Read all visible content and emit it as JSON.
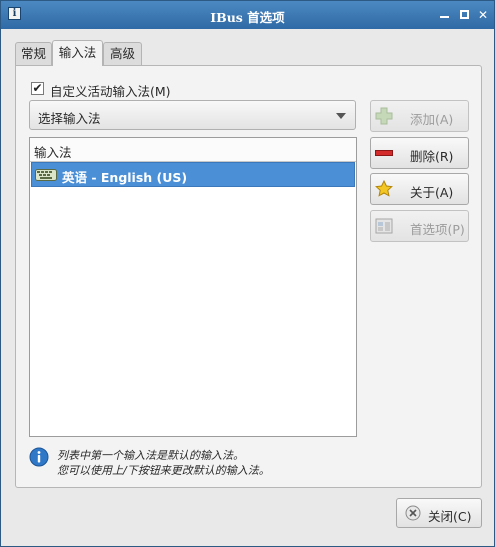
{
  "window": {
    "title": "IBus 首选项",
    "menu_glyph": "i",
    "close_glyph": "✕"
  },
  "tabs": [
    {
      "label": "常规",
      "active": false
    },
    {
      "label": "输入法",
      "active": true
    },
    {
      "label": "高级",
      "active": false
    }
  ],
  "custom_active": {
    "label": "自定义活动输入法(M)",
    "checked": true,
    "check_glyph": "✔"
  },
  "selector": {
    "placeholder": "选择输入法"
  },
  "list": {
    "header": "输入法",
    "items": [
      {
        "label": "英语 - English (US)",
        "selected": true,
        "icon": "keyboard-icon"
      }
    ]
  },
  "buttons": {
    "add": {
      "label": "添加(A)",
      "enabled": false,
      "icon": "plus-icon"
    },
    "remove": {
      "label": "删除(R)",
      "enabled": true,
      "icon": "minus-icon"
    },
    "about": {
      "label": "关于(A)",
      "enabled": true,
      "icon": "star-icon"
    },
    "prefs": {
      "label": "首选项(P)",
      "enabled": false,
      "icon": "preferences-icon"
    }
  },
  "info": {
    "line1": "列表中第一个输入法是默认的输入法。",
    "line2": "您可以使用上/下按钮来更改默认的输入法。"
  },
  "footer": {
    "close_label": "关闭(C)"
  },
  "colors": {
    "titlebar": "#3b79b6",
    "selection": "#4b8fd6"
  }
}
